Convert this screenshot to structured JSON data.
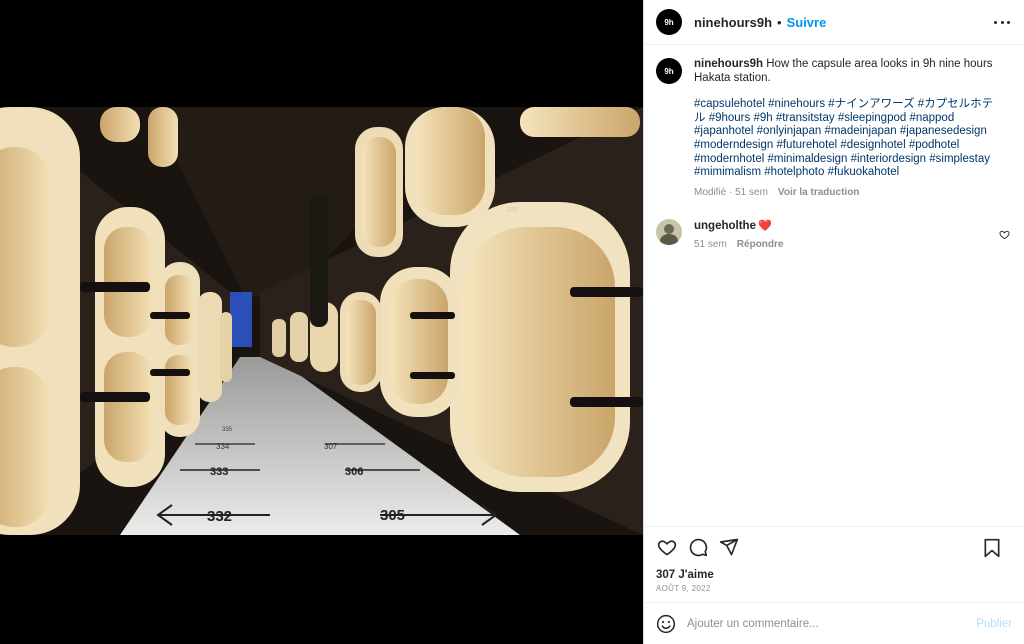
{
  "post": {
    "username": "ninehours9h",
    "avatar_text": "9h",
    "dot": "•",
    "follow_label": "Suivre",
    "caption": "How the capsule area looks in 9h nine hours Hakata station.",
    "hashtags": "#capsulehotel #ninehours #ナインアワーズ #カプセルホテル #9hours #9h #transitstay #sleepingpod #nappod #japanhotel #onlyinjapan #madeinjapan #japanesedesign #moderndesign #futurehotel #designhotel #podhotel #modernhotel #minimaldesign #interiordesign #simplestay #mimimalism #hotelphoto #fukuokahotel",
    "modified_label": "Modifié · 51 sem",
    "translate_label": "Voir la traduction",
    "likes": "307 J'aime",
    "date": "AOÛT 9, 2022"
  },
  "comment": {
    "username": "ungeholthe",
    "emoji": "❤️",
    "time": "51 sem",
    "reply_label": "Répondre"
  },
  "composer": {
    "placeholder": "Ajouter un commentaire...",
    "publish_label": "Publier"
  },
  "photo": {
    "floor_labels_right": [
      "305",
      "306",
      "307"
    ],
    "floor_labels_left": [
      "332",
      "333",
      "334",
      "335"
    ],
    "wall_label": "305"
  },
  "icons": [
    "more-icon",
    "heart-icon",
    "comment-icon",
    "share-icon",
    "bookmark-icon",
    "emoji-icon"
  ],
  "colors": {
    "link": "#0095f6",
    "hashtag": "#00376b",
    "muted": "#8e8e8e",
    "heart": "#ed4956",
    "capsule": "#e8d3a3"
  }
}
